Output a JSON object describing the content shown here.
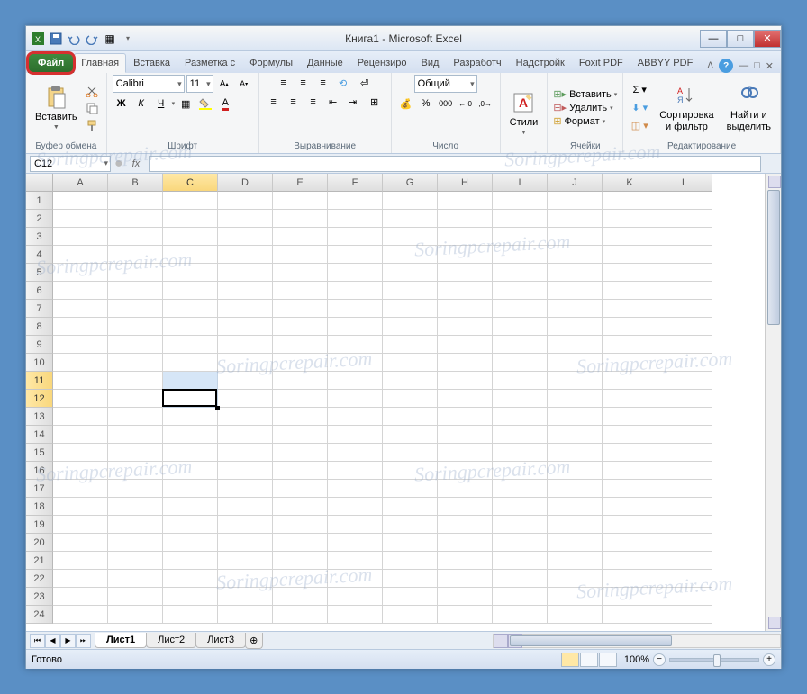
{
  "title": "Книга1 - Microsoft Excel",
  "tabs": {
    "file": "Файл",
    "list": [
      "Главная",
      "Вставка",
      "Разметка с",
      "Формулы",
      "Данные",
      "Рецензиро",
      "Вид",
      "Разработч",
      "Надстройк",
      "Foxit PDF",
      "ABBYY PDF"
    ]
  },
  "ribbon": {
    "clipboard": {
      "paste": "Вставить",
      "label": "Буфер обмена"
    },
    "font": {
      "name": "Calibri",
      "size": "11",
      "bold": "Ж",
      "italic": "К",
      "underline": "Ч",
      "label": "Шрифт"
    },
    "alignment": {
      "label": "Выравнивание"
    },
    "number": {
      "format": "Общий",
      "label": "Число"
    },
    "styles": {
      "btn": "Стили",
      "label": ""
    },
    "cells": {
      "insert": "Вставить",
      "delete": "Удалить",
      "format": "Формат",
      "label": "Ячейки"
    },
    "editing": {
      "sort": "Сортировка\nи фильтр",
      "find": "Найти и\nвыделить",
      "label": "Редактирование"
    }
  },
  "namebox": "C12",
  "fx": "fx",
  "columns": [
    "A",
    "B",
    "C",
    "D",
    "E",
    "F",
    "G",
    "H",
    "I",
    "J",
    "K",
    "L"
  ],
  "rows_count": 24,
  "selected": {
    "col": "C",
    "rows": [
      11,
      12
    ],
    "active_row": 12
  },
  "sheets": {
    "tabs": [
      "Лист1",
      "Лист2",
      "Лист3"
    ],
    "active": 0
  },
  "status": {
    "ready": "Готово",
    "zoom": "100%"
  },
  "watermark": "Soringpcrepair.com"
}
